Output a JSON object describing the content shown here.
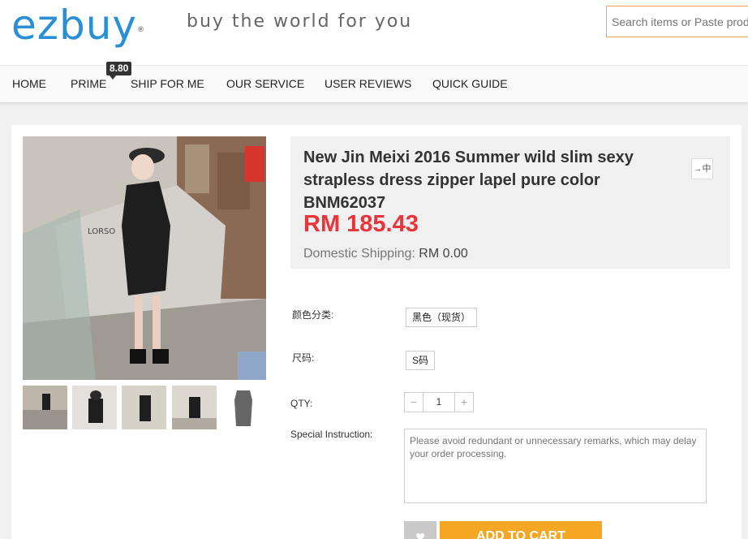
{
  "brand": {
    "logo_text": "ezbuy",
    "reg_mark": "®",
    "tagline": "buy the world for you"
  },
  "search": {
    "placeholder": "Search items or Paste product URL"
  },
  "nav": {
    "items": [
      "HOME",
      "PRIME",
      "SHIP FOR ME",
      "OUR SERVICE",
      "USER REVIEWS",
      "QUICK GUIDE"
    ],
    "prime_badge": "8.80"
  },
  "product": {
    "title": "New Jin Meixi 2016 Summer wild slim sexy strapless dress zipper lapel pure color BNM62037",
    "translate_label": "中",
    "price": "RM 185.43",
    "shipping_label": "Domestic Shipping:",
    "shipping_value": "RM 0.00"
  },
  "options": {
    "color_label": "颜色分类:",
    "color_value": "黑色（现货）",
    "size_label": "尺码:",
    "size_value": "S码",
    "qty_label": "QTY:",
    "qty_value": "1",
    "qty_minus": "−",
    "qty_plus": "+",
    "instruction_label": "Special Instruction:",
    "instruction_placeholder": "Please avoid redundant or unnecessary remarks, which may delay your order processing."
  },
  "actions": {
    "add_to_cart": "ADD TO CART"
  },
  "colors": {
    "brand_blue": "#2b8fd6",
    "price_red": "#e8343a",
    "cart_orange": "#f5a623",
    "search_border": "#f0a050"
  }
}
